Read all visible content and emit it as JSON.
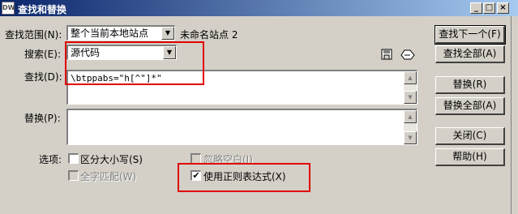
{
  "window": {
    "app_icon_text": "DW",
    "title": "查找和替换",
    "minimize": "_",
    "maximize": "□",
    "close": "×"
  },
  "search_scope": {
    "label": "查找范围(N):",
    "value": "整个当前本地站点",
    "site_name": "未命名站点 2"
  },
  "search_type": {
    "label": "搜索(E):",
    "value": "源代码"
  },
  "find": {
    "label": "查找(D):",
    "value": "\\btppabs=\"h[^\"]*\""
  },
  "replace": {
    "label": "替换(P):",
    "value": ""
  },
  "options": {
    "label": "选项:",
    "match_case": {
      "label": "区分大小写(S)",
      "checked": false,
      "enabled": true
    },
    "ignore_whitespace": {
      "label": "忽略空白(I)",
      "checked": false,
      "enabled": false
    },
    "whole_word": {
      "label": "全字匹配(W)",
      "checked": false,
      "enabled": false
    },
    "use_regex": {
      "label": "使用正则表达式(X)",
      "checked": true,
      "enabled": true
    }
  },
  "buttons": {
    "find_next": "查找下一个(F)",
    "find_all": "查找全部(A)",
    "replace": "替换(R)",
    "replace_all": "替换全部(A)",
    "close": "关闭(C)",
    "help": "帮助(H)"
  },
  "icons": {
    "save_query": "save-icon",
    "load_query": "open-query-icon"
  },
  "annotation_color": "#e00000"
}
